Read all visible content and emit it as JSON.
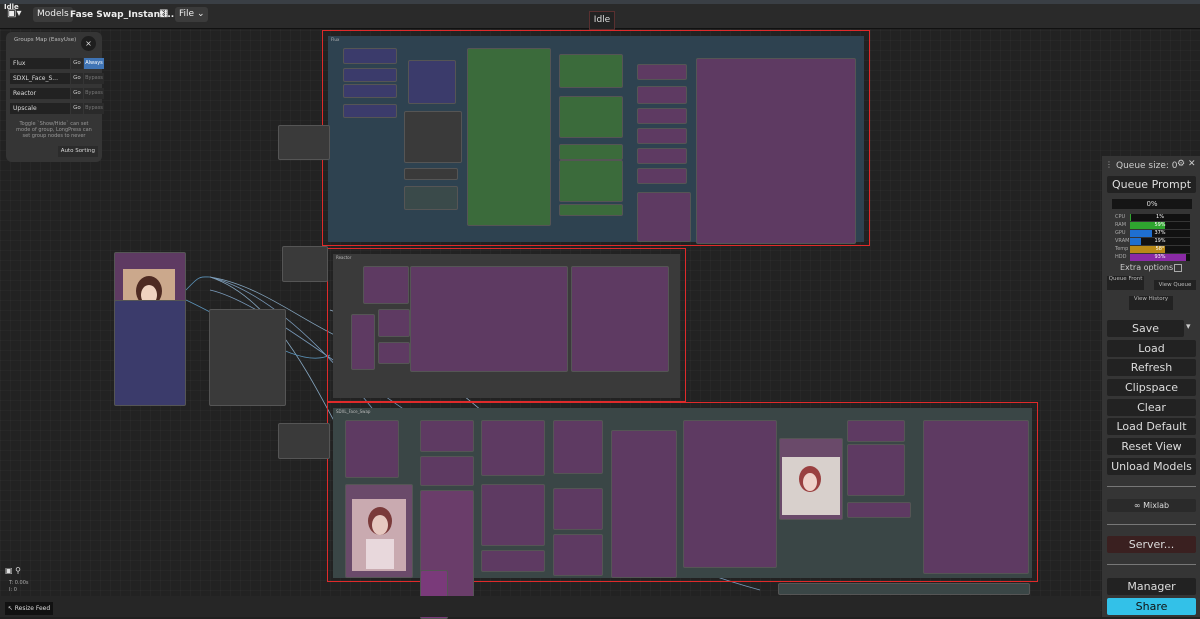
{
  "app": {
    "window_title": "Idle",
    "models_label": "Models",
    "workflow_name": "Fase Swap_Instantl...",
    "file_menu": "File",
    "status": "Idle"
  },
  "groups_map": {
    "title": "Groups Map (EasyUse)",
    "close": "×",
    "rows": [
      {
        "name": "Flux",
        "go": "Go",
        "mode": "Always"
      },
      {
        "name": "SDXL_Face_S...",
        "go": "Go",
        "mode": "Bypass"
      },
      {
        "name": "Reactor",
        "go": "Go",
        "mode": "Bypass"
      },
      {
        "name": "Upscale",
        "go": "Go",
        "mode": "Bypass"
      }
    ],
    "tip": "Toggle `Show/Hide` can set mode of group, LongPress can set group nodes to never",
    "auto_sorting": "Auto Sorting"
  },
  "group_titles": {
    "flux": "Flux",
    "reactor": "Reactor",
    "sdxl": "SDXL_Face_Swap"
  },
  "panel": {
    "queue_size": "Queue size: 0",
    "gear": "⚙",
    "close": "✕",
    "queue_prompt": "Queue Prompt",
    "progress": "0%",
    "stats": [
      {
        "label": "CPU",
        "value": "1%",
        "pct": 1,
        "color": "#2fa52f"
      },
      {
        "label": "RAM",
        "value": "59%",
        "pct": 59,
        "color": "#2fa52f"
      },
      {
        "label": "GPU",
        "value": "37%",
        "pct": 37,
        "color": "#1f6fd0"
      },
      {
        "label": "VRAM",
        "value": "19%",
        "pct": 19,
        "color": "#1f6fd0"
      },
      {
        "label": "Temp",
        "value": "58°",
        "pct": 58,
        "color": "#b98a17"
      },
      {
        "label": "HDD",
        "value": "93%",
        "pct": 93,
        "color": "#8a2aa5"
      }
    ],
    "extra_options": "Extra options",
    "queue_front": "Queue Front",
    "view_queue": "View Queue",
    "view_history": "View History",
    "save": "Save",
    "save_arrow": "▾",
    "load": "Load",
    "refresh": "Refresh",
    "clipspace": "Clipspace",
    "clear": "Clear",
    "load_default": "Load Default",
    "reset_view": "Reset View",
    "unload_models": "Unload Models",
    "mixlab": "∞ Mixlab",
    "server": "Server...",
    "manager": "Manager",
    "share": "Share"
  },
  "canvas_info": {
    "t": "T: 0.00s",
    "i": "I: 0",
    "resize_feed": "↖ Resize Feed"
  },
  "colors": {
    "group_border": "#e02a2a",
    "node_purple": "#5e3a62",
    "node_green": "#3b6b3b",
    "node_blue": "#3b3b6b",
    "share": "#33c1e8",
    "server": "#3a2020"
  }
}
